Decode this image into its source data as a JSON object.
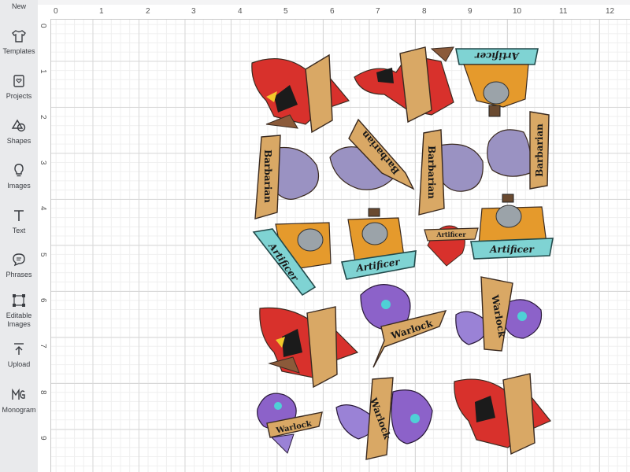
{
  "sidebar": {
    "top_label": "New",
    "items": [
      {
        "id": "templates",
        "label": "Templates",
        "icon": "tshirt-icon"
      },
      {
        "id": "projects",
        "label": "Projects",
        "icon": "projects-icon"
      },
      {
        "id": "shapes",
        "label": "Shapes",
        "icon": "shapes-icon"
      },
      {
        "id": "images",
        "label": "Images",
        "icon": "lightbulb-icon"
      },
      {
        "id": "text",
        "label": "Text",
        "icon": "text-icon"
      },
      {
        "id": "phrases",
        "label": "Phrases",
        "icon": "speech-bubble-icon"
      },
      {
        "id": "editable-images",
        "label": "Editable\nImages",
        "icon": "editable-image-icon"
      },
      {
        "id": "upload",
        "label": "Upload",
        "icon": "upload-icon"
      },
      {
        "id": "monogram",
        "label": "Monogram",
        "icon": "monogram-icon"
      }
    ]
  },
  "ruler": {
    "top": [
      "0",
      "1",
      "2",
      "3",
      "4",
      "5",
      "6",
      "7",
      "8",
      "9",
      "10",
      "11",
      "12"
    ],
    "left": [
      "0",
      "1",
      "2",
      "3",
      "4",
      "5",
      "6",
      "7",
      "8",
      "9"
    ]
  },
  "stickers": {
    "barbarian": "Barbarian",
    "artificer": "Artificer",
    "warlock": "Warlock",
    "artificer_small": "Artificer"
  },
  "colors": {
    "cardinal_red": "#d8312c",
    "banner_tan": "#d9a865",
    "teal": "#7fd3d3",
    "orange": "#e59a2c",
    "purple": "#8c62c9",
    "lavender": "#9a92c2"
  }
}
